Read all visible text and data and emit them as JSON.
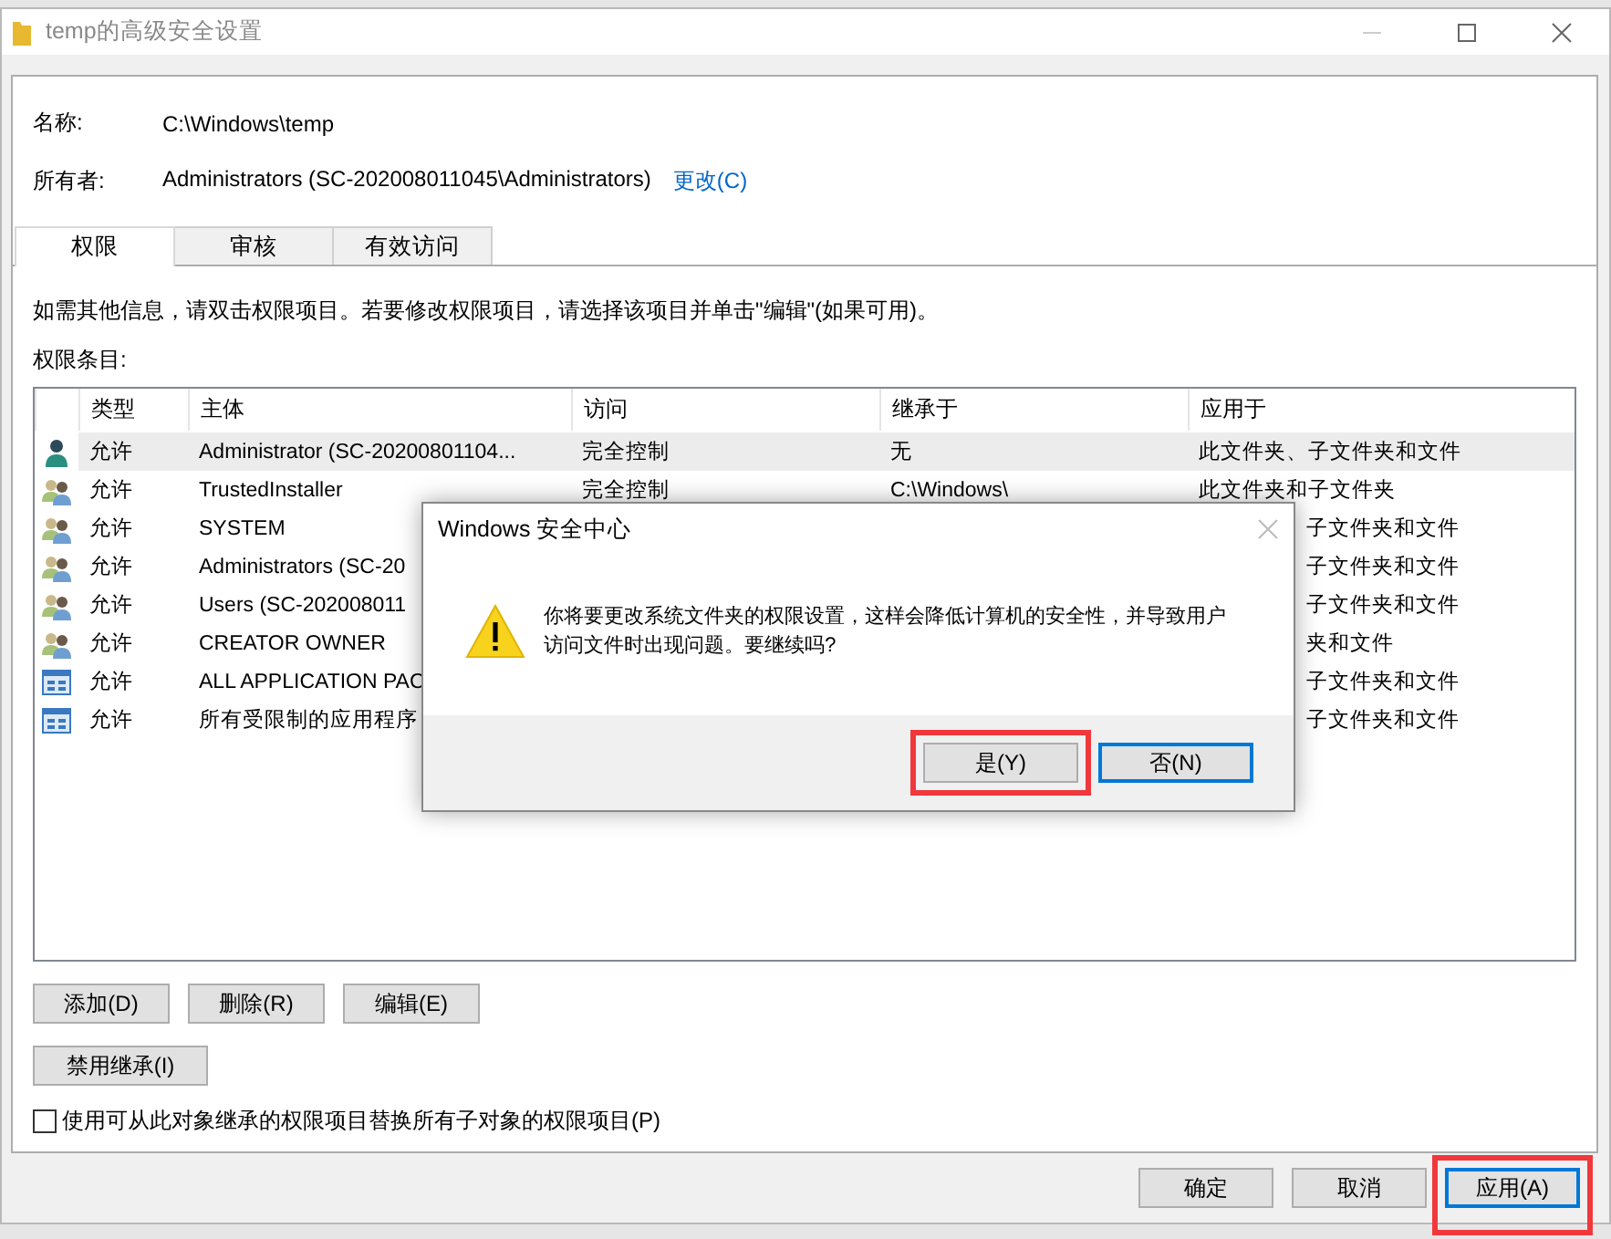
{
  "window": {
    "title": "temp的高级安全设置"
  },
  "name": {
    "label": "名称:",
    "value": "C:\\Windows\\temp"
  },
  "owner": {
    "label": "所有者:",
    "value": "Administrators (SC-202008011045\\Administrators)",
    "link": "更改(C)"
  },
  "tabs": [
    {
      "label": "权限",
      "selected": true
    },
    {
      "label": "审核",
      "selected": false
    },
    {
      "label": "有效访问",
      "selected": false
    }
  ],
  "info_text": "如需其他信息，请双击权限项目。若要修改权限项目，请选择该项目并单击\"编辑\"(如果可用)。",
  "entries_label": "权限条目:",
  "table": {
    "columns": [
      "类型",
      "主体",
      "访问",
      "继承于",
      "应用于"
    ],
    "rows": [
      {
        "kind": "user",
        "type": "允许",
        "principal": "Administrator (SC-20200801104...",
        "access": "完全控制",
        "inherited_from": "无",
        "applies_to": "此文件夹、子文件夹和文件",
        "selected": true
      },
      {
        "kind": "group",
        "type": "允许",
        "principal": "TrustedInstaller",
        "access": "完全控制",
        "inherited_from": "C:\\Windows\\",
        "applies_to": "此文件夹和子文件夹",
        "selected": false
      },
      {
        "kind": "group",
        "type": "允许",
        "principal": "SYSTEM",
        "applies_to": "子文件夹和文件",
        "selected": false
      },
      {
        "kind": "group",
        "type": "允许",
        "principal": "Administrators (SC-20",
        "applies_to": "子文件夹和文件",
        "selected": false
      },
      {
        "kind": "group",
        "type": "允许",
        "principal": "Users (SC-202008011",
        "applies_to": "子文件夹和文件",
        "selected": false
      },
      {
        "kind": "group",
        "type": "允许",
        "principal": "CREATOR OWNER",
        "applies_to": "夹和文件",
        "selected": false
      },
      {
        "kind": "package",
        "type": "允许",
        "principal": "ALL APPLICATION PAC",
        "applies_to": "子文件夹和文件",
        "selected": false
      },
      {
        "kind": "package",
        "type": "允许",
        "principal": "所有受限制的应用程序",
        "applies_to": "子文件夹和文件",
        "selected": false
      }
    ]
  },
  "buttons": [
    "添加(D)",
    "删除(R)",
    "编辑(E)"
  ],
  "disable_inheritance": "禁用继承(I)",
  "replace_checkbox": {
    "label": "使用可从此对象继承的权限项目替换所有子对象的权限项目(P)",
    "checked": false
  },
  "footer_buttons": [
    {
      "label": "确定",
      "default": false,
      "highlighted": false
    },
    {
      "label": "取消",
      "default": false,
      "highlighted": false
    },
    {
      "label": "应用(A)",
      "default": true,
      "highlighted": true
    }
  ],
  "dialog": {
    "title": "Windows 安全中心",
    "message": "你将要更改系统文件夹的权限设置，这样会降低计算机的安全性，并导致用户访问文件时出现问题。要继续吗?",
    "buttons": [
      {
        "label": "是(Y)",
        "default": false,
        "highlighted": true
      },
      {
        "label": "否(N)",
        "default": true,
        "highlighted": false
      }
    ]
  }
}
